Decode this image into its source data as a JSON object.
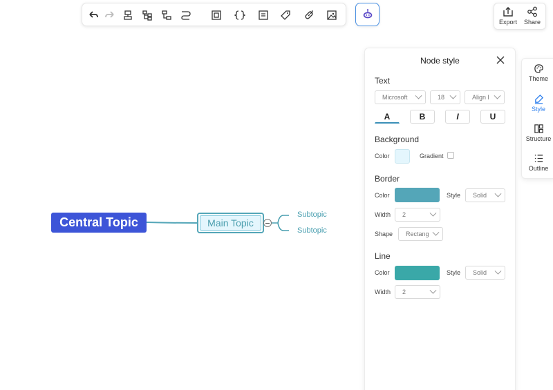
{
  "toolbar": {
    "icons": [
      "undo-icon",
      "redo-icon",
      "format-painter-icon",
      "insert-subtopic-icon",
      "insert-sibling-icon",
      "relationship-icon",
      "boundary-icon",
      "summary-icon",
      "note-icon",
      "tag-icon",
      "link-icon",
      "image-icon"
    ]
  },
  "ai_button": {
    "icon": "ai-robot-icon"
  },
  "io": {
    "export_label": "Export",
    "share_label": "Share"
  },
  "map": {
    "central_topic": "Central Topic",
    "main_topic": "Main Topic",
    "subtopics": [
      "Subtopic",
      "Subtopic"
    ],
    "colors": {
      "central": "#3d55d8",
      "branch": "#54a6b8",
      "subtopic_text": "#4a9fb0"
    }
  },
  "panel": {
    "title": "Node style",
    "text_section": "Text",
    "font_family": "Microsoft",
    "font_size": "18",
    "align": "Align l",
    "format_buttons": [
      "A",
      "B",
      "I",
      "U"
    ],
    "background_section": "Background",
    "color_label": "Color",
    "gradient_label": "Gradient",
    "background_color": "#e4f6fd",
    "border_section": "Border",
    "border_color": "#54a6b8",
    "style_label": "Style",
    "border_style": "Solid",
    "width_label": "Width",
    "border_width": "2",
    "shape_label": "Shape",
    "shape_value": "Rectang",
    "line_section": "Line",
    "line_color": "#3aa8a8",
    "line_style": "Solid",
    "line_width": "2"
  },
  "sidebar": {
    "items": [
      {
        "label": "Theme",
        "icon": "palette-icon"
      },
      {
        "label": "Style",
        "icon": "brush-icon",
        "active": true
      },
      {
        "label": "Structure",
        "icon": "structure-icon"
      },
      {
        "label": "Outline",
        "icon": "outline-icon"
      }
    ]
  }
}
